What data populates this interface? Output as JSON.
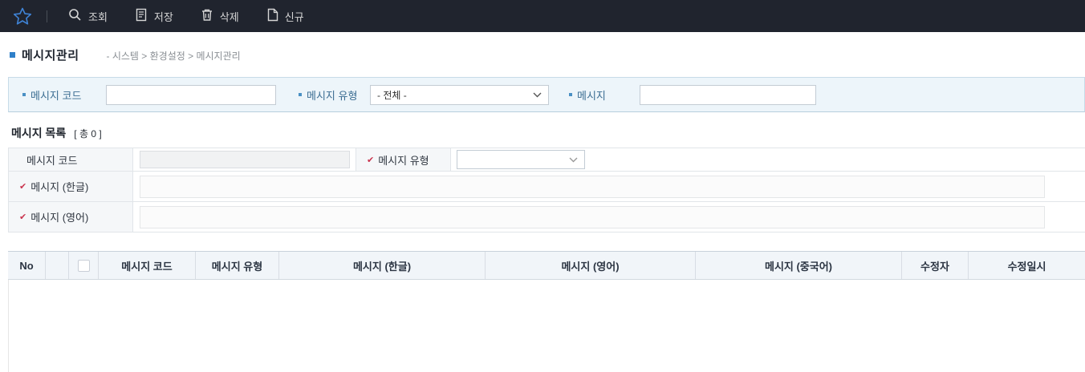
{
  "toolbar": {
    "buttons": [
      {
        "id": "search",
        "label": "조회"
      },
      {
        "id": "save",
        "label": "저장"
      },
      {
        "id": "delete",
        "label": "삭제"
      },
      {
        "id": "new",
        "label": "신규"
      }
    ]
  },
  "page": {
    "title": "메시지관리",
    "breadcrumb": "- 시스템 > 환경설정 > 메시지관리"
  },
  "search": {
    "code_label": "메시지 코드",
    "code_value": "",
    "type_label": "메시지 유형",
    "type_value": "- 전체 -",
    "message_label": "메시지",
    "message_value": ""
  },
  "list": {
    "title": "메시지 목록",
    "count": "[ 총 0 ]"
  },
  "form": {
    "check_mark": "✔",
    "code_label": "메시지 코드",
    "code_value": "",
    "type_label": "메시지 유형",
    "type_value": "",
    "korean_label": "메시지 (한글)",
    "korean_value": "",
    "english_label": "메시지 (영어)",
    "english_value": ""
  },
  "table": {
    "columns": [
      "No",
      "",
      "메시지 코드",
      "메시지 유형",
      "메시지 (한글)",
      "메시지 (영어)",
      "메시지 (중국어)",
      "수정자",
      "수정일시"
    ],
    "rows": []
  },
  "colors": {
    "toolbar_bg": "#20242e",
    "accent_blue": "#2f80c9",
    "panel_bg": "#edf5fa",
    "required_red": "#c9344e"
  }
}
